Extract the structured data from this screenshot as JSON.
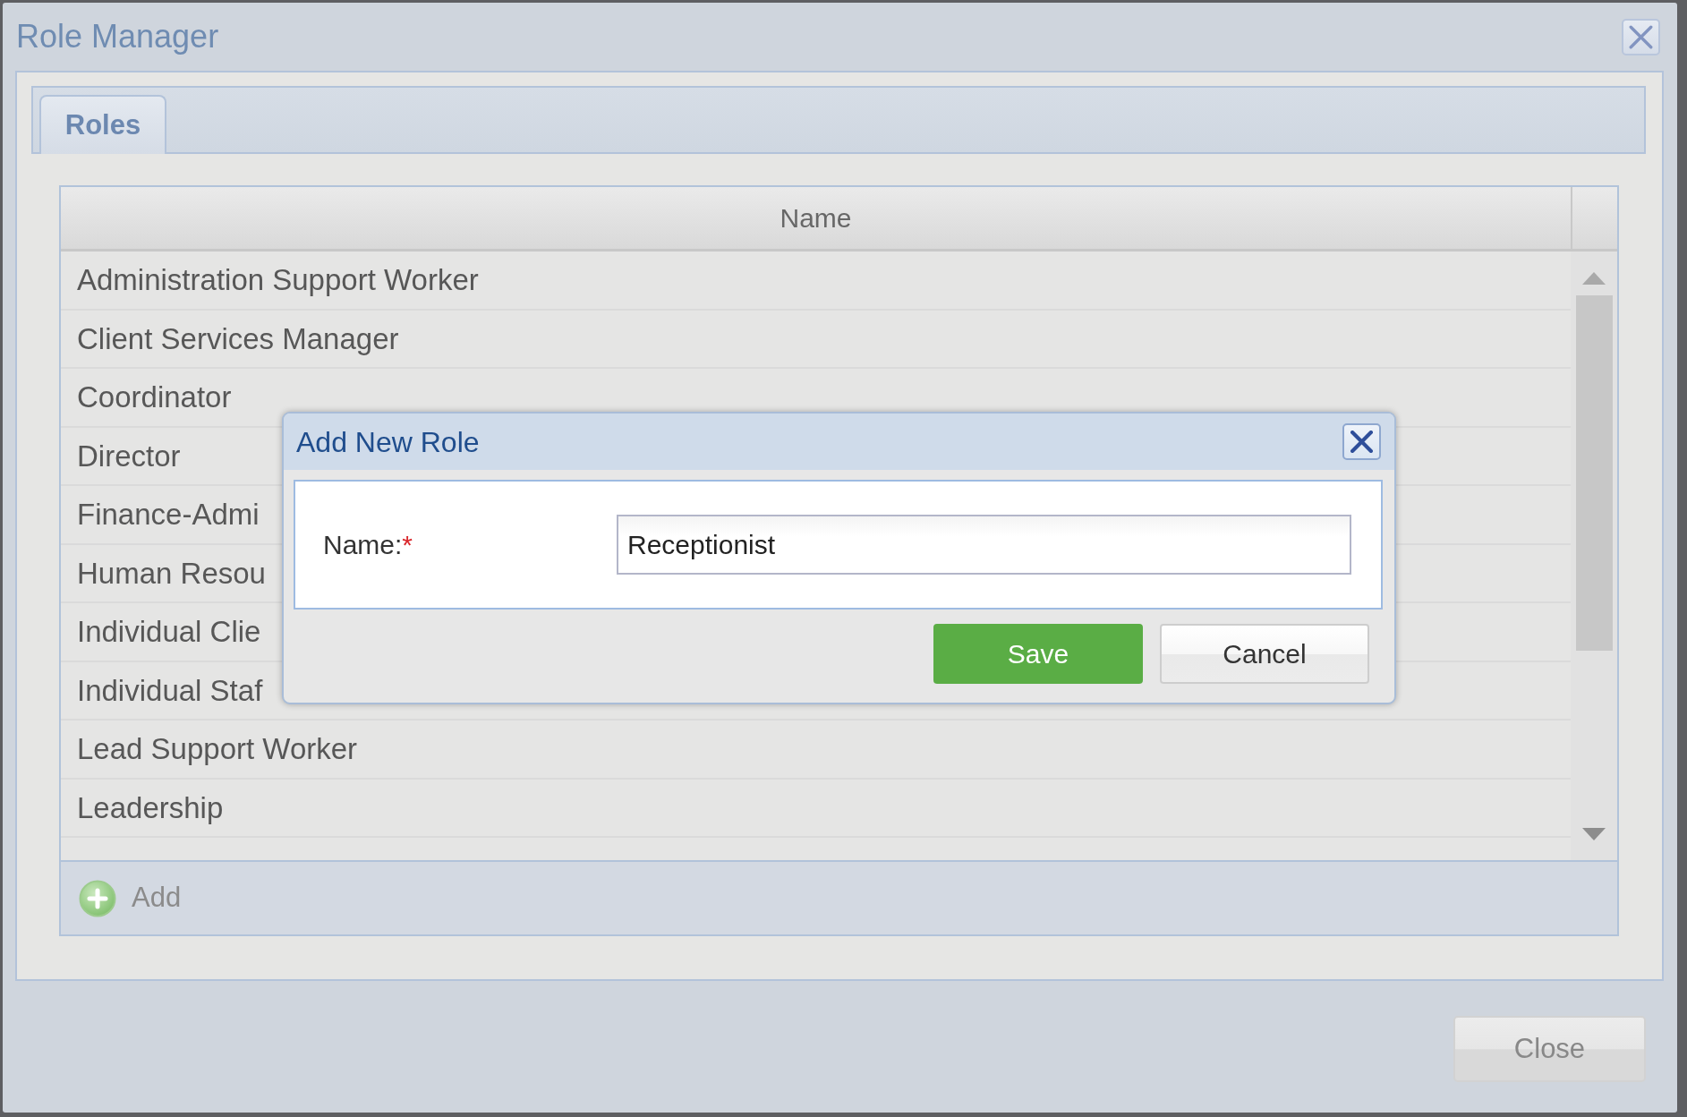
{
  "window": {
    "title": "Role Manager"
  },
  "tabs": [
    {
      "label": "Roles",
      "selected": true
    }
  ],
  "grid": {
    "columns": [
      "Name"
    ],
    "rows": [
      {
        "name": "Administration Support Worker",
        "selected": false
      },
      {
        "name": "Client Services Manager",
        "selected": false
      },
      {
        "name": "Coordinator",
        "selected": false
      },
      {
        "name": "Director",
        "selected": false
      },
      {
        "name": "Finance-Admi",
        "selected": false
      },
      {
        "name": "Human Resou",
        "selected": false
      },
      {
        "name": "Individual Clie",
        "selected": false
      },
      {
        "name": "Individual Staf",
        "selected": false
      },
      {
        "name": "Lead Support Worker",
        "selected": false
      },
      {
        "name": "Leadership",
        "selected": false
      }
    ],
    "toolbar": [
      {
        "label": "Add"
      }
    ]
  },
  "dialog": {
    "title": "Add New Role",
    "fields": [
      {
        "label": "Name:",
        "required_mark": "*",
        "value": "Receptionist"
      }
    ],
    "buttons": [
      {
        "label": "Save",
        "kind": "primary"
      },
      {
        "label": "Cancel",
        "kind": "secondary"
      }
    ]
  },
  "footer": {
    "buttons": [
      {
        "label": "Close"
      }
    ]
  }
}
